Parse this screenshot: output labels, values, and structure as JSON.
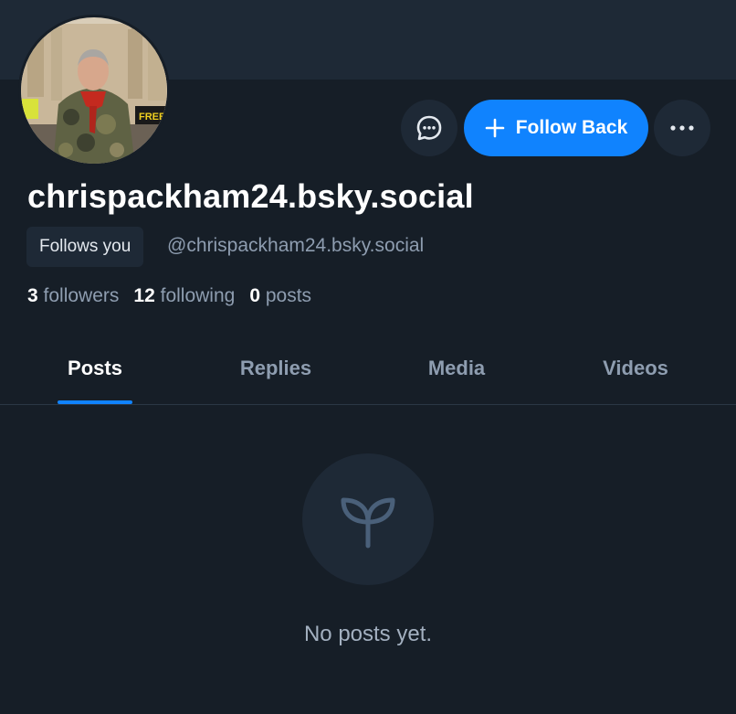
{
  "profile": {
    "display_name": "chrispackham24.bsky.social",
    "follows_you_label": "Follows you",
    "handle": "@chrispackham24.bsky.social",
    "avatar_icon": "profile-photo",
    "avatar_sign_text": "FREE"
  },
  "actions": {
    "message_icon": "chat-bubble-icon",
    "follow_label": "Follow Back",
    "follow_icon": "plus-icon",
    "more_icon": "ellipsis-icon"
  },
  "stats": {
    "followers": {
      "count": "3",
      "label": "followers"
    },
    "following": {
      "count": "12",
      "label": "following"
    },
    "posts": {
      "count": "0",
      "label": "posts"
    }
  },
  "tabs": [
    {
      "label": "Posts",
      "active": true
    },
    {
      "label": "Replies",
      "active": false
    },
    {
      "label": "Media",
      "active": false
    },
    {
      "label": "Videos",
      "active": false
    }
  ],
  "empty_state": {
    "icon": "seedling-icon",
    "text": "No posts yet."
  },
  "colors": {
    "background": "#161e27",
    "surface": "#1e2936",
    "accent": "#1083fe",
    "muted_text": "#8e9db0"
  }
}
